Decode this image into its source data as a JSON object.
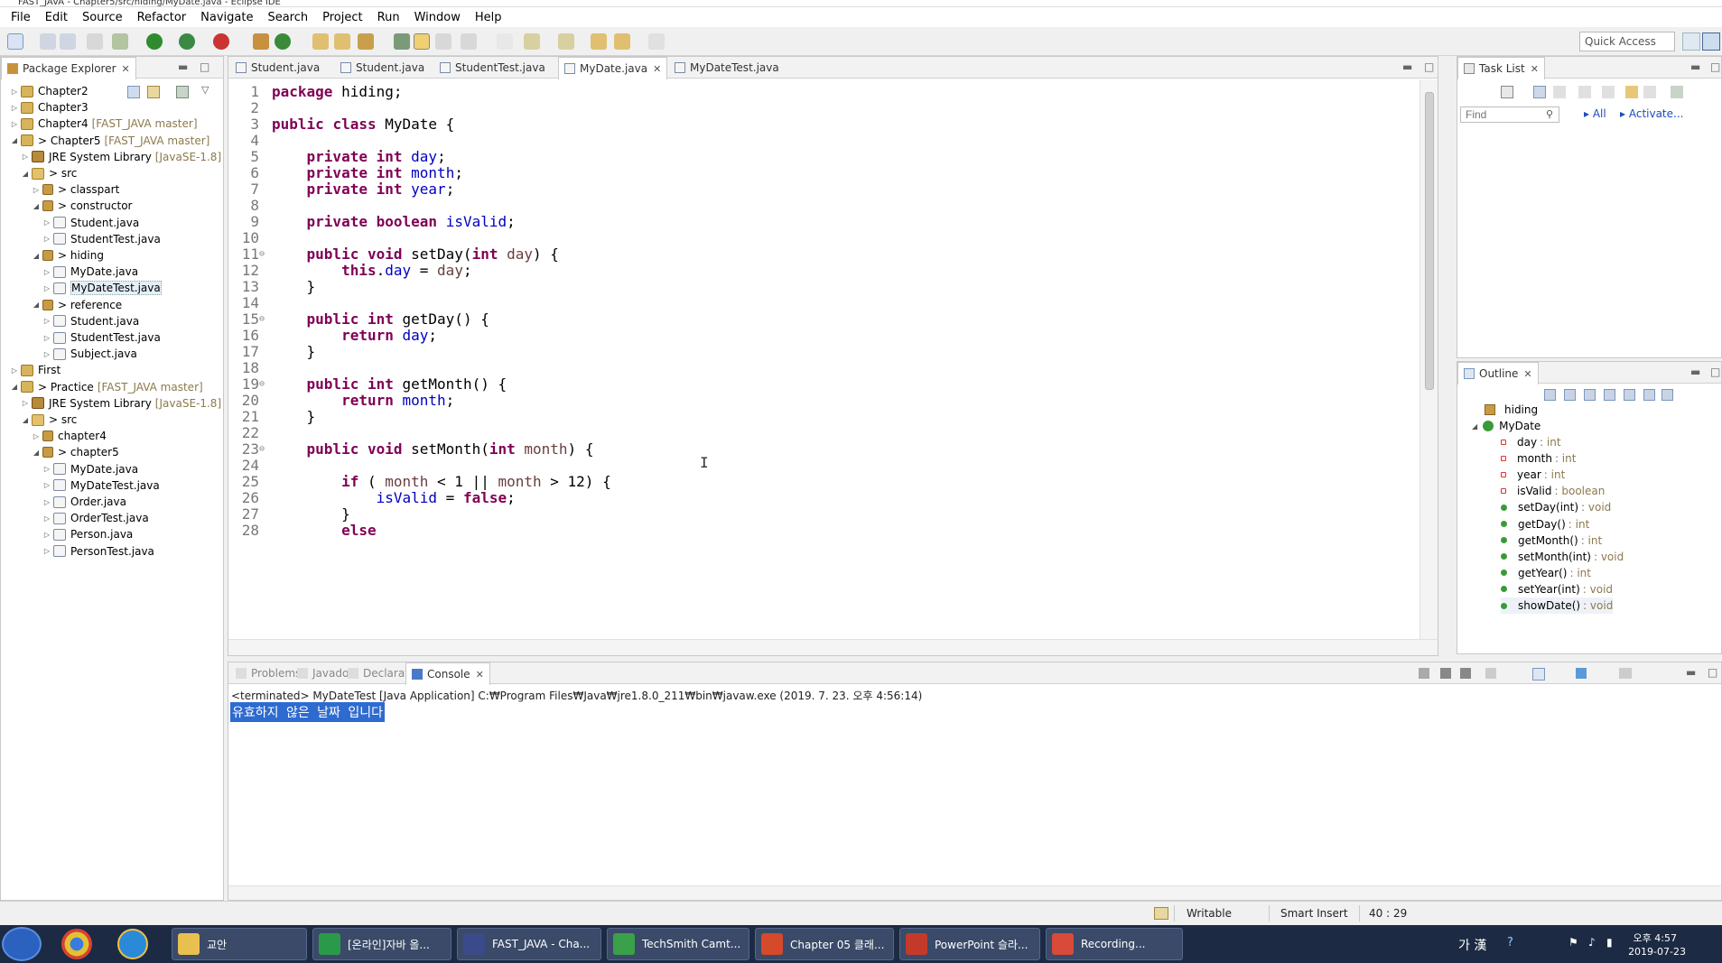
{
  "window": {
    "title": "FAST_JAVA - Chapter5/src/hiding/MyDate.java - Eclipse IDE"
  },
  "menu": [
    "File",
    "Edit",
    "Source",
    "Refactor",
    "Navigate",
    "Search",
    "Project",
    "Run",
    "Window",
    "Help"
  ],
  "toolbar": {
    "quick_access": "Quick Access"
  },
  "package_explorer": {
    "title": "Package Explorer",
    "items": [
      {
        "label": "Chapter2",
        "extra": "",
        "level": 0,
        "type": "project",
        "arrow": "▷"
      },
      {
        "label": "Chapter3",
        "extra": "",
        "level": 0,
        "type": "project",
        "arrow": "▷"
      },
      {
        "label": "Chapter4",
        "extra": "[FAST_JAVA master]",
        "level": 0,
        "type": "project",
        "arrow": "▷"
      },
      {
        "label": "> Chapter5",
        "extra": "[FAST_JAVA master]",
        "level": 0,
        "type": "project",
        "arrow": "◢"
      },
      {
        "label": "JRE System Library",
        "extra": "[JavaSE-1.8]",
        "level": 1,
        "type": "jre",
        "arrow": "▷"
      },
      {
        "label": "> src",
        "extra": "",
        "level": 1,
        "type": "src",
        "arrow": "◢"
      },
      {
        "label": "> classpart",
        "extra": "",
        "level": 2,
        "type": "pkg",
        "arrow": "▷"
      },
      {
        "label": "> constructor",
        "extra": "",
        "level": 2,
        "type": "pkg",
        "arrow": "◢"
      },
      {
        "label": "Student.java",
        "extra": "",
        "level": 3,
        "type": "java",
        "arrow": "▷"
      },
      {
        "label": "StudentTest.java",
        "extra": "",
        "level": 3,
        "type": "java",
        "arrow": "▷"
      },
      {
        "label": "> hiding",
        "extra": "",
        "level": 2,
        "type": "pkg",
        "arrow": "◢"
      },
      {
        "label": "MyDate.java",
        "extra": "",
        "level": 3,
        "type": "java",
        "arrow": "▷"
      },
      {
        "label": "MyDateTest.java",
        "extra": "",
        "level": 3,
        "type": "java",
        "arrow": "▷",
        "selected": true
      },
      {
        "label": "> reference",
        "extra": "",
        "level": 2,
        "type": "pkg",
        "arrow": "◢"
      },
      {
        "label": "Student.java",
        "extra": "",
        "level": 3,
        "type": "java",
        "arrow": "▷"
      },
      {
        "label": "StudentTest.java",
        "extra": "",
        "level": 3,
        "type": "java",
        "arrow": "▷"
      },
      {
        "label": "Subject.java",
        "extra": "",
        "level": 3,
        "type": "java",
        "arrow": "▷"
      },
      {
        "label": "First",
        "extra": "",
        "level": 0,
        "type": "project",
        "arrow": "▷"
      },
      {
        "label": "> Practice",
        "extra": "[FAST_JAVA master]",
        "level": 0,
        "type": "project",
        "arrow": "◢"
      },
      {
        "label": "JRE System Library",
        "extra": "[JavaSE-1.8]",
        "level": 1,
        "type": "jre",
        "arrow": "▷"
      },
      {
        "label": "> src",
        "extra": "",
        "level": 1,
        "type": "src",
        "arrow": "◢"
      },
      {
        "label": "chapter4",
        "extra": "",
        "level": 2,
        "type": "pkg",
        "arrow": "▷"
      },
      {
        "label": "> chapter5",
        "extra": "",
        "level": 2,
        "type": "pkg",
        "arrow": "◢"
      },
      {
        "label": "MyDate.java",
        "extra": "",
        "level": 3,
        "type": "java",
        "arrow": "▷"
      },
      {
        "label": "MyDateTest.java",
        "extra": "",
        "level": 3,
        "type": "java",
        "arrow": "▷"
      },
      {
        "label": "Order.java",
        "extra": "",
        "level": 3,
        "type": "java",
        "arrow": "▷"
      },
      {
        "label": "OrderTest.java",
        "extra": "",
        "level": 3,
        "type": "java",
        "arrow": "▷"
      },
      {
        "label": "Person.java",
        "extra": "",
        "level": 3,
        "type": "java",
        "arrow": "▷"
      },
      {
        "label": "PersonTest.java",
        "extra": "",
        "level": 3,
        "type": "java",
        "arrow": "▷"
      }
    ]
  },
  "editor": {
    "tabs": [
      {
        "label": "Student.java",
        "active": false
      },
      {
        "label": "Student.java",
        "active": false
      },
      {
        "label": "StudentTest.java",
        "active": false
      },
      {
        "label": "MyDate.java",
        "active": true
      },
      {
        "label": "MyDateTest.java",
        "active": false
      }
    ],
    "lines": [
      {
        "n": "1",
        "fold": "",
        "tokens": [
          [
            "kw",
            "package"
          ],
          [
            "t",
            " hiding;"
          ]
        ]
      },
      {
        "n": "2",
        "fold": "",
        "tokens": []
      },
      {
        "n": "3",
        "fold": "",
        "tokens": [
          [
            "kw",
            "public"
          ],
          [
            "t",
            " "
          ],
          [
            "kw",
            "class"
          ],
          [
            "t",
            " MyDate {"
          ]
        ]
      },
      {
        "n": "4",
        "fold": "",
        "tokens": []
      },
      {
        "n": "5",
        "fold": "",
        "tokens": [
          [
            "t",
            "    "
          ],
          [
            "kw",
            "private"
          ],
          [
            "t",
            " "
          ],
          [
            "kw",
            "int"
          ],
          [
            "t",
            " "
          ],
          [
            "fld",
            "day"
          ],
          [
            "t",
            ";"
          ]
        ]
      },
      {
        "n": "6",
        "fold": "",
        "tokens": [
          [
            "t",
            "    "
          ],
          [
            "kw",
            "private"
          ],
          [
            "t",
            " "
          ],
          [
            "kw",
            "int"
          ],
          [
            "t",
            " "
          ],
          [
            "fld",
            "month"
          ],
          [
            "t",
            ";"
          ]
        ]
      },
      {
        "n": "7",
        "fold": "",
        "tokens": [
          [
            "t",
            "    "
          ],
          [
            "kw",
            "private"
          ],
          [
            "t",
            " "
          ],
          [
            "kw",
            "int"
          ],
          [
            "t",
            " "
          ],
          [
            "fld",
            "year"
          ],
          [
            "t",
            ";"
          ]
        ]
      },
      {
        "n": "8",
        "fold": "",
        "tokens": []
      },
      {
        "n": "9",
        "fold": "",
        "tokens": [
          [
            "t",
            "    "
          ],
          [
            "kw",
            "private"
          ],
          [
            "t",
            " "
          ],
          [
            "kw",
            "boolean"
          ],
          [
            "t",
            " "
          ],
          [
            "fld",
            "isValid"
          ],
          [
            "t",
            ";"
          ]
        ]
      },
      {
        "n": "10",
        "fold": "",
        "tokens": []
      },
      {
        "n": "11",
        "fold": "⊖",
        "tokens": [
          [
            "t",
            "    "
          ],
          [
            "kw",
            "public"
          ],
          [
            "t",
            " "
          ],
          [
            "kw",
            "void"
          ],
          [
            "t",
            " setDay("
          ],
          [
            "kw",
            "int"
          ],
          [
            "t",
            " "
          ],
          [
            "prm",
            "day"
          ],
          [
            "t",
            ") {"
          ]
        ]
      },
      {
        "n": "12",
        "fold": "",
        "tokens": [
          [
            "t",
            "        "
          ],
          [
            "kw",
            "this"
          ],
          [
            "t",
            "."
          ],
          [
            "fld",
            "day"
          ],
          [
            "t",
            " = "
          ],
          [
            "prm",
            "day"
          ],
          [
            "t",
            ";"
          ]
        ]
      },
      {
        "n": "13",
        "fold": "",
        "tokens": [
          [
            "t",
            "    }"
          ]
        ]
      },
      {
        "n": "14",
        "fold": "",
        "tokens": []
      },
      {
        "n": "15",
        "fold": "⊖",
        "tokens": [
          [
            "t",
            "    "
          ],
          [
            "kw",
            "public"
          ],
          [
            "t",
            " "
          ],
          [
            "kw",
            "int"
          ],
          [
            "t",
            " getDay() {"
          ]
        ]
      },
      {
        "n": "16",
        "fold": "",
        "tokens": [
          [
            "t",
            "        "
          ],
          [
            "kw",
            "return"
          ],
          [
            "t",
            " "
          ],
          [
            "fld",
            "day"
          ],
          [
            "t",
            ";"
          ]
        ]
      },
      {
        "n": "17",
        "fold": "",
        "tokens": [
          [
            "t",
            "    }"
          ]
        ]
      },
      {
        "n": "18",
        "fold": "",
        "tokens": []
      },
      {
        "n": "19",
        "fold": "⊖",
        "tokens": [
          [
            "t",
            "    "
          ],
          [
            "kw",
            "public"
          ],
          [
            "t",
            " "
          ],
          [
            "kw",
            "int"
          ],
          [
            "t",
            " getMonth() {"
          ]
        ]
      },
      {
        "n": "20",
        "fold": "",
        "tokens": [
          [
            "t",
            "        "
          ],
          [
            "kw",
            "return"
          ],
          [
            "t",
            " "
          ],
          [
            "fld",
            "month"
          ],
          [
            "t",
            ";"
          ]
        ]
      },
      {
        "n": "21",
        "fold": "",
        "tokens": [
          [
            "t",
            "    }"
          ]
        ]
      },
      {
        "n": "22",
        "fold": "",
        "tokens": []
      },
      {
        "n": "23",
        "fold": "⊖",
        "tokens": [
          [
            "t",
            "    "
          ],
          [
            "kw",
            "public"
          ],
          [
            "t",
            " "
          ],
          [
            "kw",
            "void"
          ],
          [
            "t",
            " setMonth("
          ],
          [
            "kw",
            "int"
          ],
          [
            "t",
            " "
          ],
          [
            "prm",
            "month"
          ],
          [
            "t",
            ") {"
          ]
        ]
      },
      {
        "n": "24",
        "fold": "",
        "tokens": []
      },
      {
        "n": "25",
        "fold": "",
        "tokens": [
          [
            "t",
            "        "
          ],
          [
            "kw",
            "if"
          ],
          [
            "t",
            " ( "
          ],
          [
            "prm",
            "month"
          ],
          [
            "t",
            " < 1 || "
          ],
          [
            "prm",
            "month"
          ],
          [
            "t",
            " > 12) {"
          ]
        ]
      },
      {
        "n": "26",
        "fold": "",
        "tokens": [
          [
            "t",
            "            "
          ],
          [
            "fld",
            "isValid"
          ],
          [
            "t",
            " = "
          ],
          [
            "kw",
            "false"
          ],
          [
            "t",
            ";"
          ]
        ]
      },
      {
        "n": "27",
        "fold": "",
        "tokens": [
          [
            "t",
            "        }"
          ]
        ]
      },
      {
        "n": "28",
        "fold": "",
        "tokens": [
          [
            "t",
            "        "
          ],
          [
            "kw",
            "else"
          ]
        ]
      }
    ],
    "text_cursor": "I"
  },
  "task_list": {
    "title": "Task List",
    "find_placeholder": "Find",
    "all_label": "All",
    "activate_label": "Activate..."
  },
  "outline": {
    "title": "Outline",
    "package": "hiding",
    "class": "MyDate",
    "members": [
      {
        "name": "day",
        "type": ": int",
        "visibility": "private"
      },
      {
        "name": "month",
        "type": ": int",
        "visibility": "private"
      },
      {
        "name": "year",
        "type": ": int",
        "visibility": "private"
      },
      {
        "name": "isValid",
        "type": ": boolean",
        "visibility": "private"
      },
      {
        "name": "setDay(int)",
        "type": ": void",
        "visibility": "public"
      },
      {
        "name": "getDay()",
        "type": ": int",
        "visibility": "public"
      },
      {
        "name": "getMonth()",
        "type": ": int",
        "visibility": "public"
      },
      {
        "name": "setMonth(int)",
        "type": ": void",
        "visibility": "public"
      },
      {
        "name": "getYear()",
        "type": ": int",
        "visibility": "public"
      },
      {
        "name": "setYear(int)",
        "type": ": void",
        "visibility": "public"
      },
      {
        "name": "showDate()",
        "type": ": void",
        "visibility": "public"
      }
    ]
  },
  "console_panel": {
    "tabs": [
      {
        "label": "Problems",
        "active": false
      },
      {
        "label": "Javadoc",
        "active": false
      },
      {
        "label": "Declaration",
        "active": false
      },
      {
        "label": "Console",
        "active": true
      }
    ],
    "terminated": "<terminated> MyDateTest [Java Application] C:₩Program Files₩Java₩jre1.8.0_211₩bin₩javaw.exe (2019. 7. 23. 오후 4:56:14)",
    "output": "유효하지 않은 날짜 입니다"
  },
  "status_bar": {
    "writable": "Writable",
    "insert_mode": "Smart Insert",
    "position": "40 : 29"
  },
  "taskbar": {
    "tasks": [
      "교안",
      "[온라인]자바 올...",
      "FAST_JAVA - Cha...",
      "TechSmith Camt...",
      "Chapter 05 클래...",
      "PowerPoint 슬라...",
      "Recording..."
    ],
    "ime": "가 漢",
    "time": "오후 4:57",
    "date": "2019-07-23"
  },
  "colors": {
    "keyword": "#7f0055",
    "field": "#0000c0",
    "param": "#6a3e3e",
    "selection": "#2e6bd0"
  }
}
